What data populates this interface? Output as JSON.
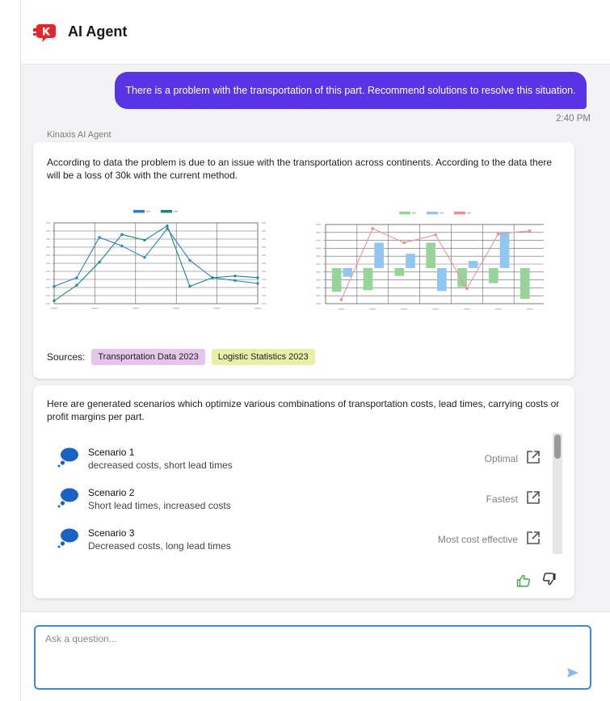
{
  "app": {
    "title": "AI Agent"
  },
  "conversation": {
    "user_message": "There is a problem with the transportation of this part. Recommend solutions to resolve this situation.",
    "user_time": "2:40 PM",
    "agent_name": "Kinaxis AI Agent"
  },
  "analysis": {
    "text": "According to data the problem is due to an issue with the transportation across continents. According to the data there will be a loss of 30k with the current method.",
    "sources_label": "Sources:",
    "sources": [
      "Transportation Data 2023",
      "Logistic Statistics 2023"
    ]
  },
  "chart_data": [
    {
      "type": "line",
      "categories": [
        "1",
        "2",
        "3",
        "4",
        "5",
        "6",
        "7",
        "8",
        "9",
        "10"
      ],
      "series": [
        {
          "values": [
            -3,
            -1.5,
            5.5,
            4,
            2,
            7,
            1.5,
            -1.5,
            -2,
            -2.5
          ],
          "color": "#2b7fd0"
        },
        {
          "values": [
            -5.5,
            -2.8,
            1.2,
            6,
            5,
            7.5,
            -3,
            -1.5,
            -1.2,
            -1.5
          ],
          "color": "#15897e"
        }
      ],
      "ylim": [
        -6,
        8
      ],
      "grid": true,
      "legend": "top"
    },
    {
      "type": "bar",
      "categories": [
        "1",
        "2",
        "3",
        "4",
        "5",
        "6",
        "7"
      ],
      "series": [
        {
          "type": "bar",
          "values": [
            -3,
            -2.8,
            -1,
            3.2,
            -2.4,
            -1.9,
            -3.9
          ],
          "color": "#98d49a"
        },
        {
          "type": "bar",
          "values": [
            -1.1,
            3.2,
            1.8,
            -2.9,
            0.9,
            4.6,
            0
          ],
          "color": "#91c6f1"
        },
        {
          "type": "line",
          "values": [
            -4,
            5,
            3.2,
            4.2,
            -2.6,
            4.3,
            4.7
          ],
          "color": "#ef8e8e"
        }
      ],
      "ylim": [
        -4.5,
        5.5
      ],
      "grid": true,
      "legend": "top"
    }
  ],
  "scenarios": {
    "intro": "Here are generated scenarios which optimize various combinations of transportation costs, lead times, carrying costs or profit margins per part.",
    "items": [
      {
        "title": "Scenario 1",
        "desc": "decreased costs, short lead times",
        "tag": "Optimal"
      },
      {
        "title": "Scenario 2",
        "desc": "Short lead times, increased costs",
        "tag": "Fastest"
      },
      {
        "title": "Scenario 3",
        "desc": "Decreased costs, long lead times",
        "tag": "Most cost effective"
      }
    ]
  },
  "composer": {
    "placeholder": "Ask a question..."
  },
  "colors": {
    "accent": "#5834e5",
    "brand": "#e8242a",
    "scenario_icon": "#1a63c4",
    "like": "#3caa3c",
    "input_border": "#3f8ad6",
    "source_chip_1": "#e6c5ec",
    "source_chip_2": "#e8f0a8"
  },
  "icons": {
    "logo": "kinaxis-k-logo",
    "scenario": "chat-bubble-icon",
    "open": "open-in-new-icon",
    "like": "thumbs-up-icon",
    "dislike": "thumbs-down-icon",
    "send": "send-icon"
  }
}
